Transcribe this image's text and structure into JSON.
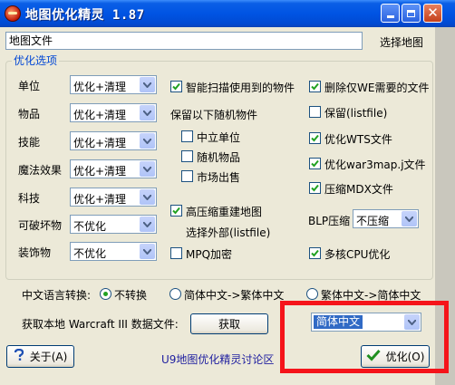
{
  "window": {
    "title": "地图优化精灵 1.87"
  },
  "map_file": {
    "value": "地图文件",
    "select_label": "选择地图"
  },
  "options_group": {
    "legend": "优化选项",
    "rows": [
      {
        "label": "单位",
        "value": "优化+清理"
      },
      {
        "label": "物品",
        "value": "优化+清理"
      },
      {
        "label": "技能",
        "value": "优化+清理"
      },
      {
        "label": "魔法效果",
        "value": "优化+清理"
      },
      {
        "label": "科技",
        "value": "优化+清理"
      },
      {
        "label": "可破坏物",
        "value": "不优化"
      },
      {
        "label": "装饰物",
        "value": "不优化"
      }
    ],
    "middle": {
      "smart_scan": {
        "label": "智能扫描使用到的物件",
        "checked": true
      },
      "keep_random_label": "保留以下随机物件",
      "neutral_units": {
        "label": "中立单位",
        "checked": false
      },
      "random_items": {
        "label": "随机物品",
        "checked": false
      },
      "market_sale": {
        "label": "市场出售",
        "checked": false
      },
      "high_compress": {
        "label": "高压缩重建地图",
        "checked": true
      },
      "choose_external": "选择外部(listfile)",
      "mpq_encrypt": {
        "label": "MPQ加密",
        "checked": false
      }
    },
    "right": {
      "delete_we": {
        "label": "删除仅WE需要的文件",
        "checked": true
      },
      "keep_listfile": {
        "label": "保留(listfile)",
        "checked": false
      },
      "optimize_wts": {
        "label": "优化WTS文件",
        "checked": true
      },
      "optimize_war3map": {
        "label": "优化war3map.j文件",
        "checked": true
      },
      "compress_mdx": {
        "label": "压缩MDX文件",
        "checked": true
      },
      "blp_label": "BLP压缩",
      "blp_value": "不压缩",
      "multicore": {
        "label": "多核CPU优化",
        "checked": true
      }
    }
  },
  "language": {
    "label": "中文语言转换:",
    "options": [
      {
        "label": "不转换",
        "checked": true
      },
      {
        "label": "简体中文->繁体中文",
        "checked": false
      },
      {
        "label": "繁体中文->简体中文",
        "checked": false
      }
    ]
  },
  "warcraft": {
    "label": "获取本地 Warcraft III 数据文件:",
    "get_button": "获取",
    "language_value": "简体中文"
  },
  "footer": {
    "about_button": "关于(A)",
    "forum_link": "U9地图优化精灵讨论区",
    "optimize_button": "优化(O)"
  },
  "colors": {
    "titlebar": "#0054e3",
    "window_bg": "#ece9d8",
    "highlight_border": "#f5141a",
    "group_legend": "#0046d5",
    "selection": "#316ac5"
  }
}
